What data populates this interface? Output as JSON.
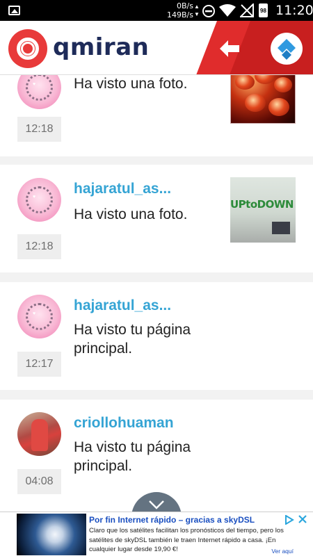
{
  "status_bar": {
    "net_up": "0B/s",
    "net_down": "149B/s",
    "battery": "98",
    "time": "11:20"
  },
  "app_bar": {
    "logo_text": "qmiran"
  },
  "feed": [
    {
      "username": "",
      "message": "Ha visto una foto.",
      "time": "12:18",
      "avatar": "pink",
      "thumb": "food"
    },
    {
      "username": "hajaratul_as...",
      "message": "Ha visto una foto.",
      "time": "12:18",
      "avatar": "pink",
      "thumb": "office",
      "thumb_text": "UPtoDOWN"
    },
    {
      "username": "hajaratul_as...",
      "message": "Ha visto tu página principal.",
      "time": "12:17",
      "avatar": "pink"
    },
    {
      "username": "criollohuaman",
      "message": "Ha visto tu página principal.",
      "time": "04:08",
      "avatar": "photo"
    }
  ],
  "ad": {
    "title": "Por fin Internet rápido – gracias a skyDSL",
    "body": "Claro que los satélites facilitan los pronósticos del tiempo, pero los satélites de skyDSL también le traen Internet rápido a casa. ¡En cualquier lugar desde 19,90 €!",
    "more": "Ver aquí"
  },
  "colors": {
    "brand_red": "#e83a3a",
    "username_blue": "#35a4d4",
    "logo_navy": "#1e2b59"
  }
}
